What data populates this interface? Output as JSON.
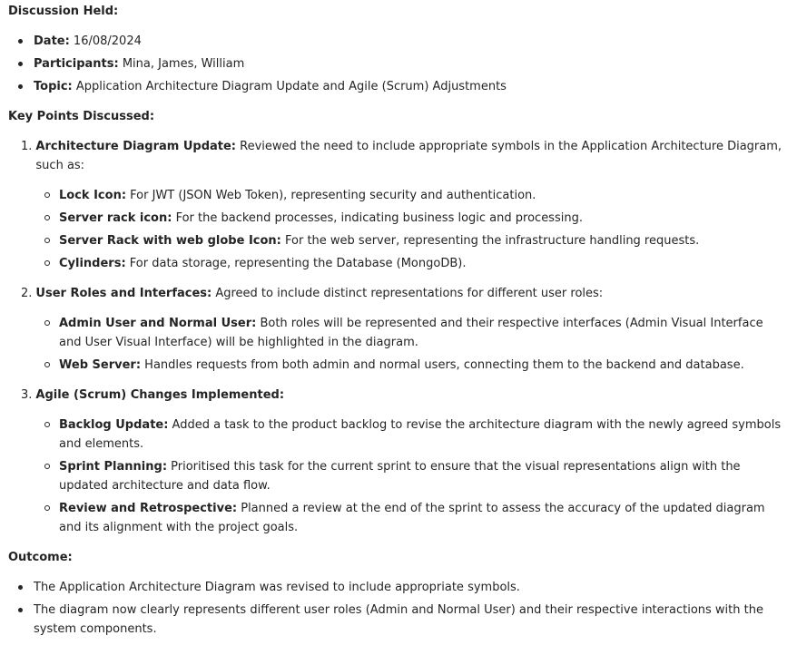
{
  "discussion": {
    "heading": "Discussion Held:",
    "items": [
      {
        "label": "Date:",
        "text": " 16/08/2024"
      },
      {
        "label": "Participants:",
        "text": " Mina, James, William"
      },
      {
        "label": "Topic:",
        "text": " Application Architecture Diagram Update and Agile (Scrum) Adjustments"
      }
    ]
  },
  "key_points": {
    "heading": "Key Points Discussed:",
    "points": [
      {
        "number": "1.",
        "label": "Architecture Diagram Update:",
        "text": " Reviewed the need to include appropriate symbols in the Application Architecture Diagram, such as:",
        "sub": [
          {
            "label": "Lock Icon:",
            "text": " For JWT (JSON Web Token), representing security and authentication."
          },
          {
            "label": "Server rack icon:",
            "text": " For the backend processes, indicating business logic and processing."
          },
          {
            "label": "Server Rack with web globe Icon:",
            "text": " For the web server, representing the infrastructure handling requests."
          },
          {
            "label": "Cylinders:",
            "text": " For data storage, representing the Database (MongoDB)."
          }
        ]
      },
      {
        "number": "2.",
        "label": "User Roles and Interfaces:",
        "text": " Agreed to include distinct representations for different user roles:",
        "sub": [
          {
            "label": "Admin User and Normal User:",
            "text": " Both roles will be represented and their respective interfaces (Admin Visual Interface and User Visual Interface) will be highlighted in the diagram."
          },
          {
            "label": "Web Server:",
            "text": " Handles requests from both admin and normal users, connecting them to the backend and database."
          }
        ]
      },
      {
        "number": "3.",
        "label": "Agile (Scrum) Changes Implemented:",
        "text": "",
        "sub": [
          {
            "label": "Backlog Update:",
            "text": " Added a task to the product backlog to revise the architecture diagram with the newly agreed symbols and elements."
          },
          {
            "label": "Sprint Planning:",
            "text": " Prioritised this task for the current sprint to ensure that the visual representations align with the updated architecture and data flow."
          },
          {
            "label": "Review and Retrospective:",
            "text": " Planned a review at the end of the sprint to assess the accuracy of the updated diagram and its alignment with the project goals."
          }
        ]
      }
    ]
  },
  "outcome": {
    "heading": "Outcome:",
    "items": [
      "The Application Architecture Diagram was revised to include appropriate symbols.",
      "The diagram now clearly represents different user roles (Admin and Normal User) and their respective interactions with the system components."
    ]
  }
}
